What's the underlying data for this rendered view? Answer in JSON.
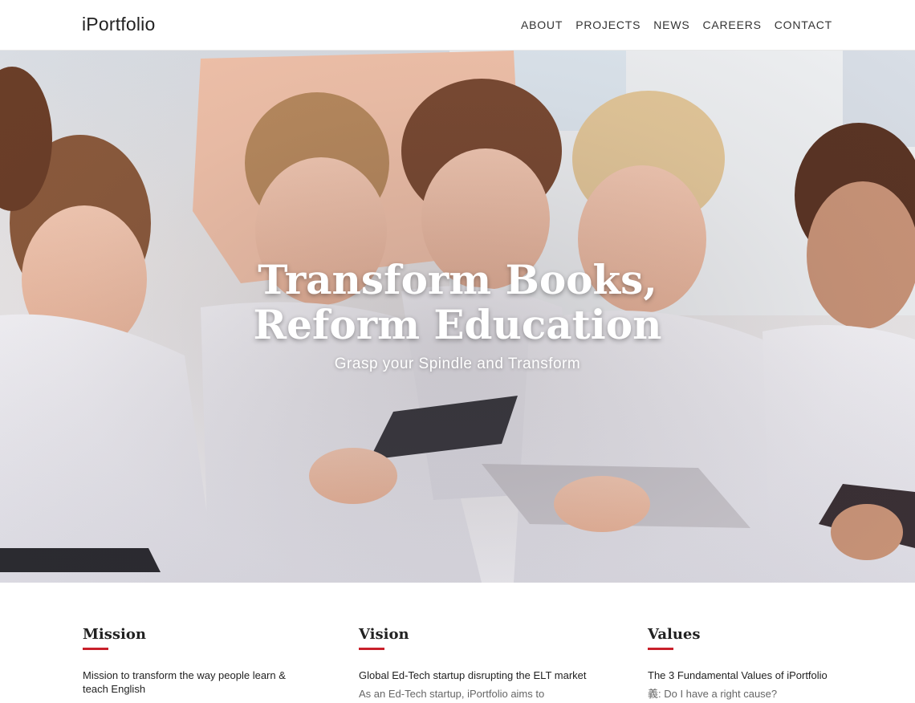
{
  "header": {
    "logo": "iPortfolio",
    "nav": [
      "ABOUT",
      "PROJECTS",
      "NEWS",
      "CAREERS",
      "CONTACT"
    ]
  },
  "hero": {
    "title_line1": "Transform Books,",
    "title_line2": "Reform Education",
    "subtitle": "Grasp your Spindle and Transform"
  },
  "sections": {
    "mission": {
      "title": "Mission",
      "text": "Mission to transform the way people learn & teach English"
    },
    "vision": {
      "title": "Vision",
      "text": "Global Ed-Tech startup disrupting the ELT market",
      "more": "As an Ed-Tech startup, iPortfolio aims to"
    },
    "values": {
      "title": "Values",
      "text": "The 3 Fundamental Values of iPortfolio",
      "more": "義: Do I have a right cause?"
    }
  },
  "colors": {
    "accent": "#c8202b"
  }
}
